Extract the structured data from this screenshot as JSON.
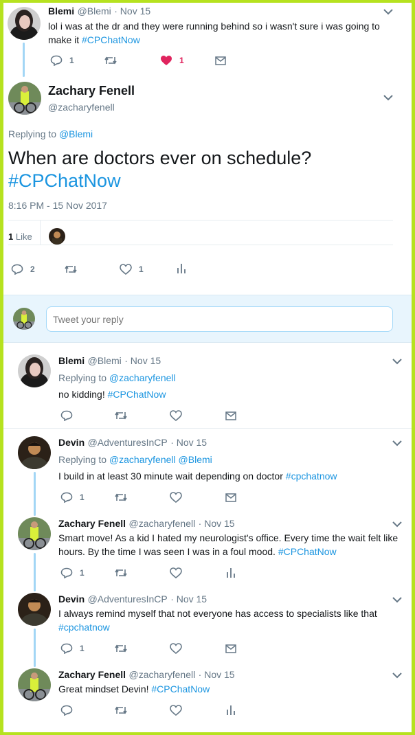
{
  "tweet1": {
    "name": "Blemi",
    "handle": "@Blemi",
    "date": "· Nov 15",
    "text": "lol i was at the dr and they were running behind so i wasn't sure i was going to make it",
    "hashtag": "#CPChatNow",
    "reply_count": "1",
    "like_count": "1"
  },
  "main": {
    "name": "Zachary Fenell",
    "handle": "@zacharyfenell",
    "replying_prefix": "Replying to",
    "replying_to": "@Blemi",
    "text": "When are doctors ever on schedule?",
    "hashtag": "#CPChatNow",
    "timestamp": "8:16 PM - 15 Nov 2017",
    "likes_number": "1",
    "likes_label": "Like",
    "reply_count": "2",
    "like_count": "1"
  },
  "compose": {
    "placeholder": "Tweet your reply"
  },
  "reply1": {
    "name": "Blemi",
    "handle": "@Blemi",
    "date": "· Nov 15",
    "replying_prefix": "Replying to",
    "replying_to": "@zacharyfenell",
    "text": "no kidding!",
    "hashtag": "#CPChatNow"
  },
  "reply2": {
    "name": "Devin",
    "handle": "@AdventuresInCP",
    "date": "· Nov 15",
    "replying_prefix": "Replying to",
    "replying_to": "@zacharyfenell @Blemi",
    "text": "I build in at least 30 minute wait depending on doctor",
    "hashtag": "#cpchatnow",
    "reply_count": "1"
  },
  "reply3": {
    "name": "Zachary Fenell",
    "handle": "@zacharyfenell",
    "date": "· Nov 15",
    "text_line1": "Smart move! As a kid I hated my neurologist's office. Every time the wait felt like",
    "text_line2": "hours. By the time I was seen I was in a foul mood.",
    "hashtag": "#CPChatNow",
    "reply_count": "1"
  },
  "reply4": {
    "name": "Devin",
    "handle": "@AdventuresInCP",
    "date": "· Nov 15",
    "text": "I always remind myself that not everyone has access to specialists like that",
    "hashtag": "#cpchatnow",
    "reply_count": "1"
  },
  "reply5": {
    "name": "Zachary Fenell",
    "handle": "@zacharyfenell",
    "date": "· Nov 15",
    "text": "Great mindset Devin!",
    "hashtag": "#CPChatNow"
  },
  "colors": {
    "border": "#b6e21f",
    "link": "#1b95e0",
    "heart": "#e0245e",
    "thread": "#a2d6f5",
    "muted": "#657786"
  },
  "icons": [
    "chevron-down-icon",
    "reply-icon",
    "retweet-icon",
    "like-icon",
    "message-icon",
    "analytics-icon"
  ]
}
